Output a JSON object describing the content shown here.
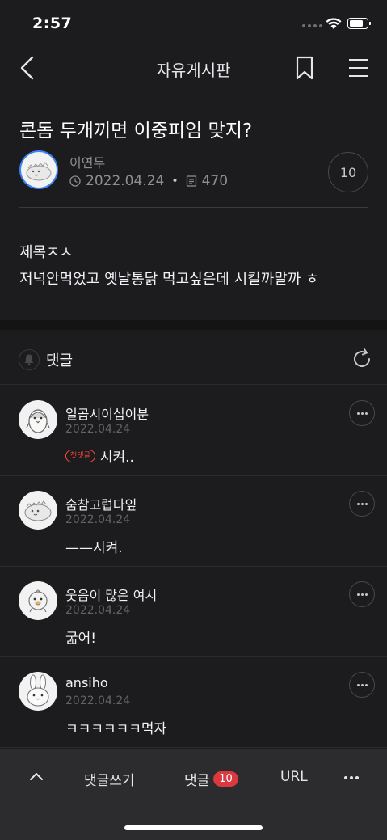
{
  "status_bar": {
    "time": "2:57"
  },
  "nav": {
    "title": "자유게시판"
  },
  "post": {
    "title": "콘돔 두개끼면 이중피임 맞지?",
    "author": "이연두",
    "date": "2022.04.24",
    "views": "470",
    "comment_count": "10",
    "body_lines": [
      "제목ㅈㅅ",
      "저녁안먹었고 옛날통닭 먹고싶은데 시킬까말까 ㅎ"
    ]
  },
  "comments_section": {
    "label": "댓글"
  },
  "comments": [
    {
      "name": "일곱시이십이분",
      "date": "2022.04.24",
      "badge": "첫댓글",
      "text": "시켜..",
      "avatar": "penguin-avatar"
    },
    {
      "name": "숨참고럽다잎",
      "date": "2022.04.24",
      "badge": "",
      "text": "——시켜.",
      "avatar": "lizard-avatar"
    },
    {
      "name": "웃음이 많은 여시",
      "date": "2022.04.24",
      "badge": "",
      "text": "굶어!",
      "avatar": "chick-avatar"
    },
    {
      "name": "ansiho",
      "date": "2022.04.24",
      "badge": "",
      "text": "ㅋㅋㅋㅋㅋㅋ먹자",
      "avatar": "bunny-avatar"
    }
  ],
  "bottom_bar": {
    "write_label": "댓글쓰기",
    "comments_label": "댓글",
    "comments_count": "10",
    "url_label": "URL"
  },
  "colors": {
    "background": "#1c1c1e",
    "bottom_bar": "#2c2c2e",
    "badge_red": "#d9393f",
    "first_comment_red": "#ff453a",
    "avatar_ring": "#3b82f6"
  }
}
